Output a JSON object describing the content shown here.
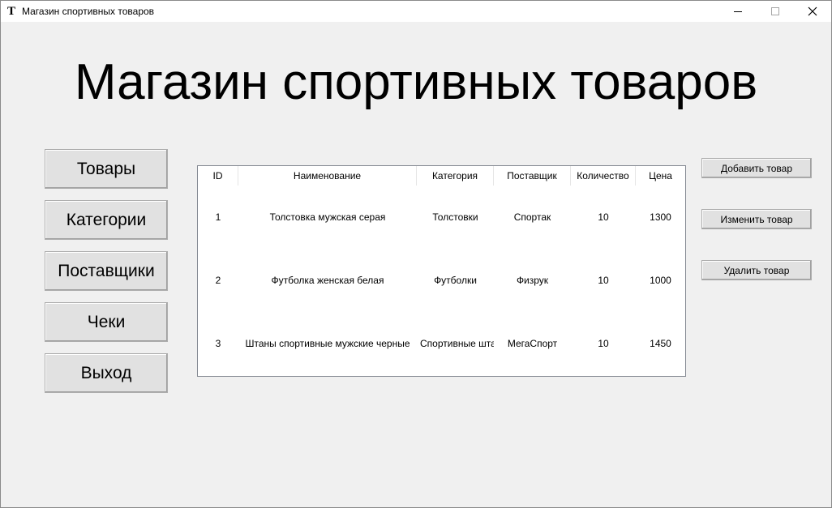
{
  "window": {
    "title": "Магазин спортивных товаров",
    "icon_letter": "T",
    "controls": {
      "minimize_icon": "minimize-icon",
      "maximize_icon": "maximize-icon",
      "close_icon": "close-icon"
    }
  },
  "heading": "Магазин спортивных товаров",
  "nav": [
    "Товары",
    "Категории",
    "Поставщики",
    "Чеки",
    "Выход"
  ],
  "table": {
    "columns": [
      "ID",
      "Наименование",
      "Категория",
      "Поставщик",
      "Количество",
      "Цена"
    ],
    "rows": [
      [
        "1",
        "Толстовка мужская серая",
        "Толстовки",
        "Спортак",
        "10",
        "1300"
      ],
      [
        "2",
        "Футболка женская белая",
        "Футболки",
        "Физрук",
        "10",
        "1000"
      ],
      [
        "3",
        "Штаны спортивные мужские черные",
        "Спортивные штаны",
        "МегаСпорт",
        "10",
        "1450"
      ]
    ]
  },
  "actions": [
    "Добавить товар",
    "Изменить товар",
    "Удалить товар"
  ]
}
